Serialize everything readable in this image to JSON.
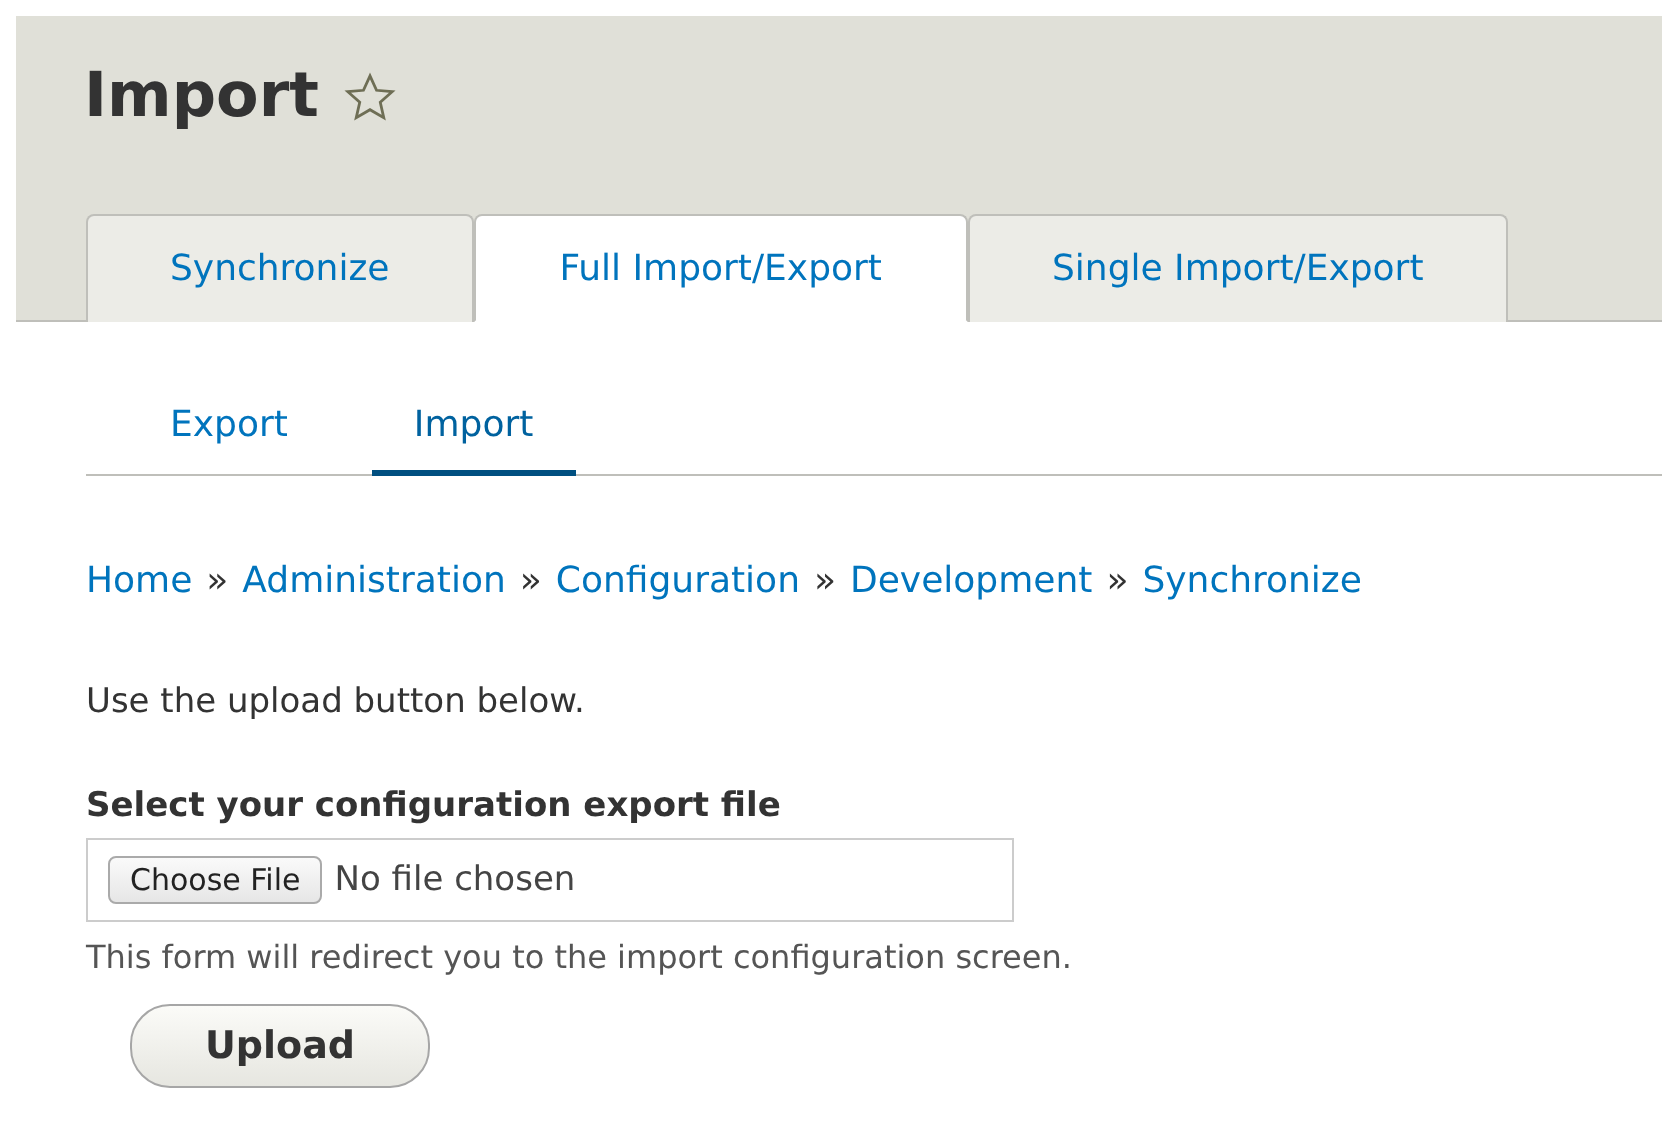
{
  "page_title": "Import",
  "primary_tabs": [
    {
      "label": "Synchronize",
      "selected": false
    },
    {
      "label": "Full Import/Export",
      "selected": true
    },
    {
      "label": "Single Import/Export",
      "selected": false
    }
  ],
  "secondary_tabs": [
    {
      "label": "Export",
      "selected": false
    },
    {
      "label": "Import",
      "selected": true
    }
  ],
  "breadcrumb": [
    "Home",
    "Administration",
    "Configuration",
    "Development",
    "Synchronize"
  ],
  "breadcrumb_separator": "»",
  "intro": "Use the upload button below.",
  "file_field": {
    "label": "Select your configuration export file",
    "button": "Choose File",
    "value": "No file chosen",
    "description": "This form will redirect you to the import configuration screen."
  },
  "submit_button": "Upload"
}
